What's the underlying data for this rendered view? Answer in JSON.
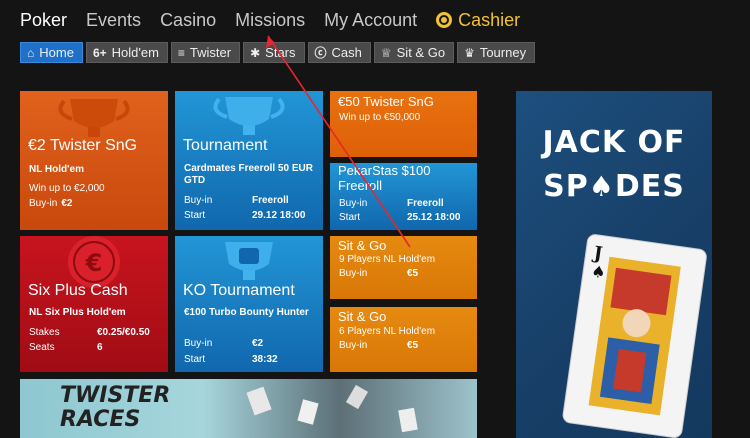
{
  "topnav": {
    "poker": "Poker",
    "events": "Events",
    "casino": "Casino",
    "missions": "Missions",
    "account": "My Account",
    "cashier": "Cashier"
  },
  "subnav": {
    "home": "Home",
    "holdem_icon": "6+",
    "holdem": "Hold'em",
    "twister": "Twister",
    "stars": "Stars",
    "cash": "Cash",
    "sitgo": "Sit & Go",
    "tourney": "Tourney"
  },
  "tiles": {
    "twister2": {
      "title": "€2 Twister SnG",
      "sub": "NL Hold'em",
      "win": "Win up to €2,000",
      "buyin_label": "Buy-in",
      "buyin_value": "€2"
    },
    "tournament": {
      "title": "Tournament",
      "sub": "Cardmates Freeroll 50 EUR GTD",
      "buyin_label": "Buy-in",
      "buyin_value": "Freeroll",
      "start_label": "Start",
      "start_value": "29.12 18:00"
    },
    "twister50": {
      "title": "€50 Twister SnG",
      "win": "Win up to €50,000"
    },
    "pekarstas": {
      "title": "PekarStas $100 Freeroll",
      "buyin_label": "Buy-in",
      "buyin_value": "Freeroll",
      "start_label": "Start",
      "start_value": "25.12 18:00"
    },
    "sixplus": {
      "title": "Six Plus Cash",
      "sub": "NL Six Plus Hold'em",
      "stakes_label": "Stakes",
      "stakes_value": "€0.25/€0.50",
      "seats_label": "Seats",
      "seats_value": "6"
    },
    "ko": {
      "title": "KO Tournament",
      "sub": "€100 Turbo Bounty Hunter",
      "buyin_label": "Buy-in",
      "buyin_value": "€2",
      "start_label": "Start",
      "start_value": "38:32"
    },
    "sitgo1": {
      "title": "Sit & Go",
      "players": "9 Players NL Hold'em",
      "buyin_label": "Buy-in",
      "buyin_value": "€5"
    },
    "sitgo2": {
      "title": "Sit & Go",
      "players": "6 Players NL Hold'em",
      "buyin_label": "Buy-in",
      "buyin_value": "€5"
    }
  },
  "ad": {
    "line1": "JACK OF",
    "line2_a": "SP",
    "line2_b": "DES"
  },
  "banner": {
    "line1": "TWISTER",
    "line2": "RACES"
  },
  "colors": {
    "accent": "#1e70c8",
    "cashier": "#f2c230",
    "arrow": "#e8262e"
  }
}
